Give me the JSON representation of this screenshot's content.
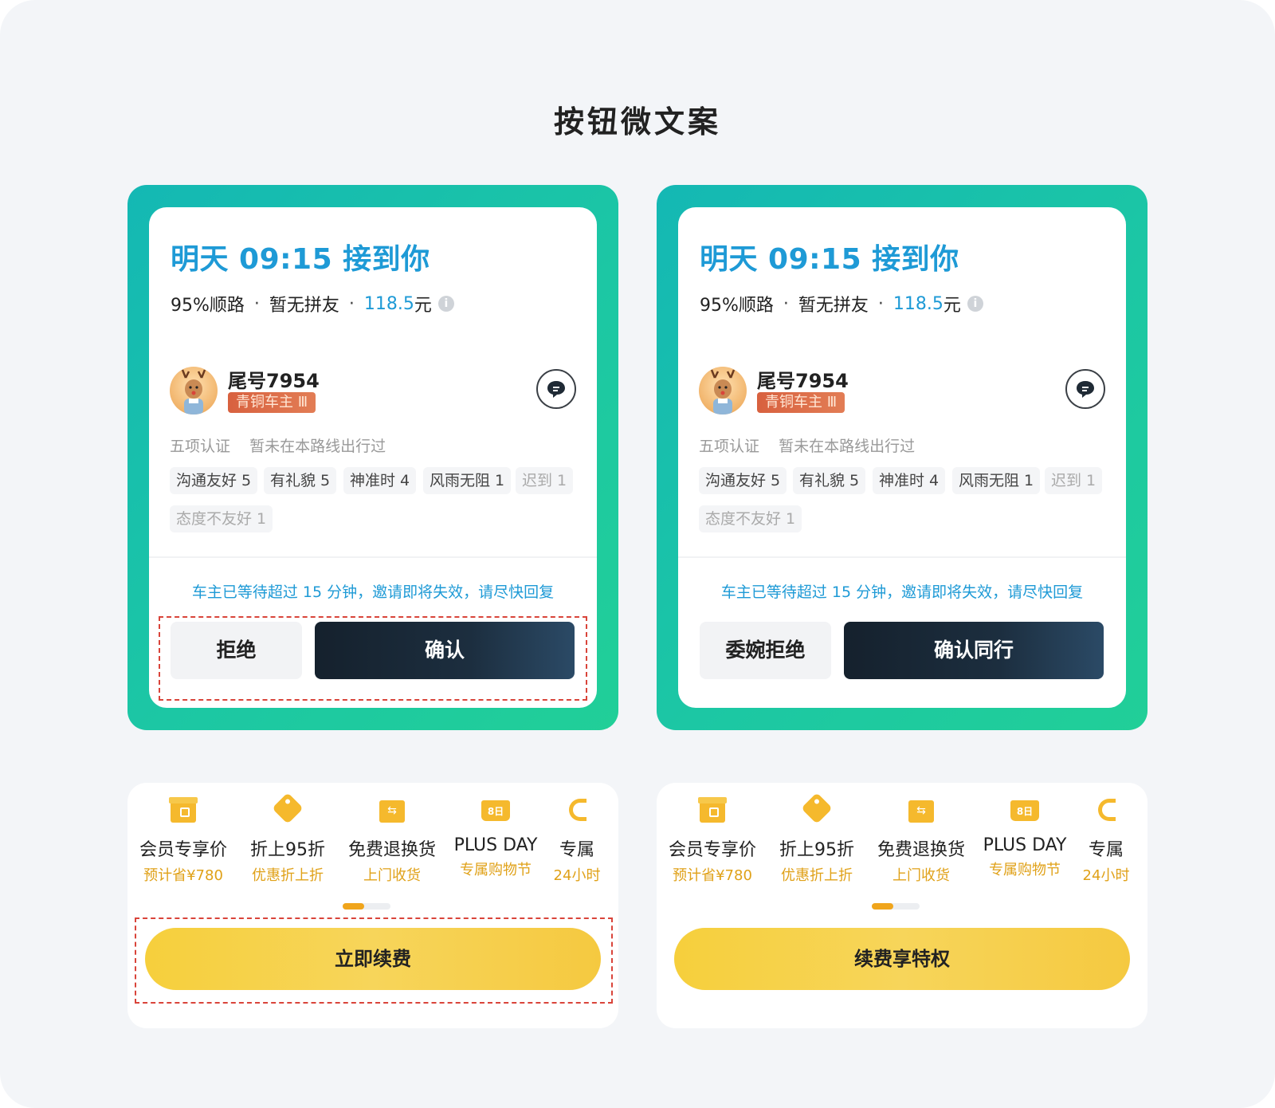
{
  "page": {
    "title": "按钮微文案"
  },
  "trip_cards": [
    {
      "title": "明天 09:15 接到你",
      "route_match": "95%顺路",
      "carpool": "暂无拼友",
      "price": "118.5",
      "price_unit": "元",
      "driver_name": "尾号7954",
      "driver_level": "青铜车主 Ⅲ",
      "cert_label": "五项认证",
      "history_note": "暂未在本路线出行过",
      "tags": [
        "沟通友好 5",
        "有礼貌 5",
        "神准时 4",
        "风雨无阻 1",
        "迟到 1",
        "态度不友好 1"
      ],
      "warning": "车主已等待超过 15 分钟，邀请即将失效，请尽快回复",
      "reject_label": "拒绝",
      "confirm_label": "确认"
    },
    {
      "title": "明天 09:15 接到你",
      "route_match": "95%顺路",
      "carpool": "暂无拼友",
      "price": "118.5",
      "price_unit": "元",
      "driver_name": "尾号7954",
      "driver_level": "青铜车主 Ⅲ",
      "cert_label": "五项认证",
      "history_note": "暂未在本路线出行过",
      "tags": [
        "沟通友好 5",
        "有礼貌 5",
        "神准时 4",
        "风雨无阻 1",
        "迟到 1",
        "态度不友好 1"
      ],
      "warning": "车主已等待超过 15 分钟，邀请即将失效，请尽快回复",
      "reject_label": "委婉拒绝",
      "confirm_label": "确认同行"
    }
  ],
  "member_cards": [
    {
      "benefits": [
        {
          "icon": "gift-icon",
          "title": "会员专享价",
          "sub": "预计省¥780"
        },
        {
          "icon": "discount-tag-icon",
          "title": "折上95折",
          "sub": "优惠折上折"
        },
        {
          "icon": "return-box-icon",
          "title": "免费退换货",
          "sub": "上门收货"
        },
        {
          "icon": "crown-icon",
          "title": "PLUS DAY",
          "sub": "专属购物节"
        },
        {
          "icon": "headset-icon",
          "title": "专属",
          "sub": "24小时"
        }
      ],
      "pager_progress": 0.45,
      "cta_label": "立即续费"
    },
    {
      "benefits": [
        {
          "icon": "gift-icon",
          "title": "会员专享价",
          "sub": "预计省¥780"
        },
        {
          "icon": "discount-tag-icon",
          "title": "折上95折",
          "sub": "优惠折上折"
        },
        {
          "icon": "return-box-icon",
          "title": "免费退换货",
          "sub": "上门收货"
        },
        {
          "icon": "crown-icon",
          "title": "PLUS DAY",
          "sub": "专属购物节"
        },
        {
          "icon": "headset-icon",
          "title": "专属",
          "sub": "24小时"
        }
      ],
      "pager_progress": 0.45,
      "cta_label": "续费享特权"
    }
  ],
  "colors": {
    "accent_blue": "#1e9ad6",
    "frame_teal": "#1cc7a4",
    "confirm_dark": "#15212d",
    "cta_yellow": "#f6cf3c",
    "highlight_dash": "#d9443a",
    "benefit_sub": "#e0a118"
  }
}
